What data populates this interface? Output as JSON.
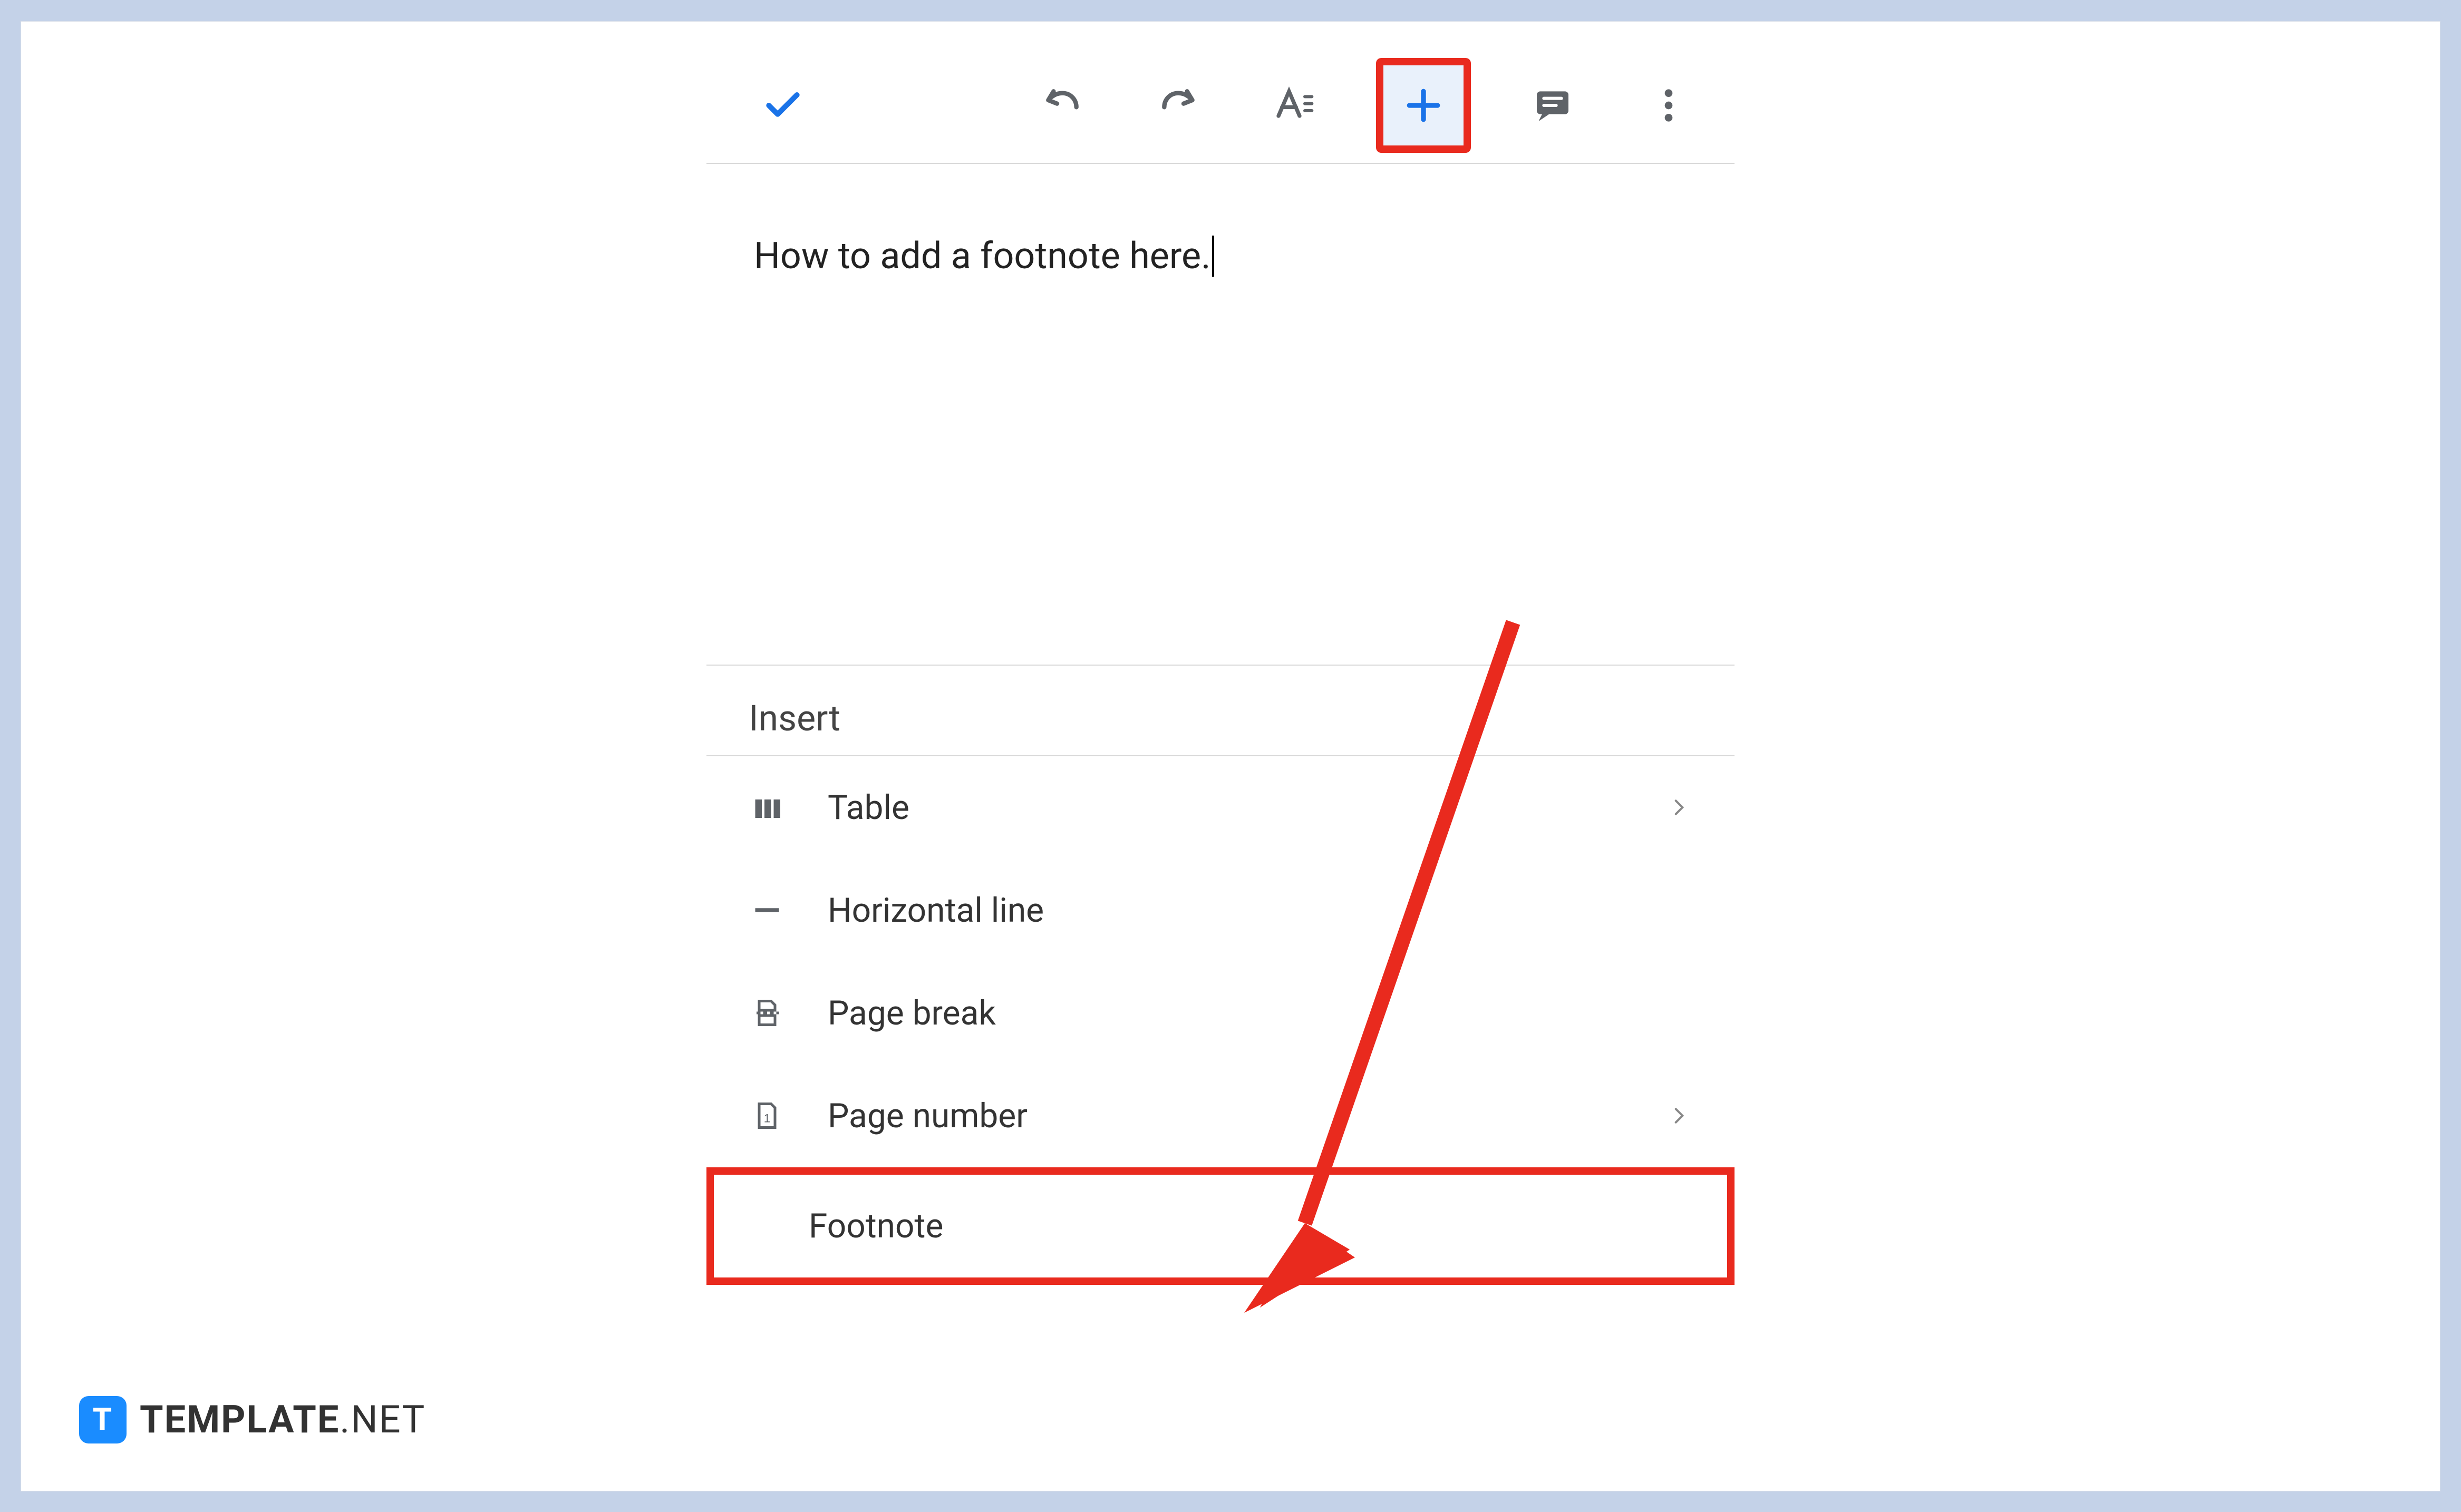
{
  "toolbar": {
    "done_icon": "checkmark",
    "undo_icon": "undo",
    "redo_icon": "redo",
    "format_icon": "text-format",
    "insert_icon": "plus",
    "comment_icon": "comment",
    "more_icon": "more-vertical"
  },
  "document": {
    "text": "How to add a footnote here."
  },
  "insert_menu": {
    "title": "Insert",
    "items": [
      {
        "label": "Table",
        "icon": "table",
        "has_submenu": true
      },
      {
        "label": "Horizontal line",
        "icon": "horizontal-line",
        "has_submenu": false
      },
      {
        "label": "Page break",
        "icon": "page-break",
        "has_submenu": false
      },
      {
        "label": "Page number",
        "icon": "page-number",
        "has_submenu": true
      },
      {
        "label": "Footnote",
        "icon": "footnote",
        "has_submenu": false
      }
    ]
  },
  "annotations": {
    "highlight_toolbar_button": "insert",
    "highlight_menu_item": "Footnote",
    "arrow_from": "insert-button",
    "arrow_to": "footnote-item",
    "arrow_color": "#e92a1e"
  },
  "watermark": {
    "brand": "TEMPLATE",
    "suffix": ".NET",
    "logo_letter": "T"
  }
}
